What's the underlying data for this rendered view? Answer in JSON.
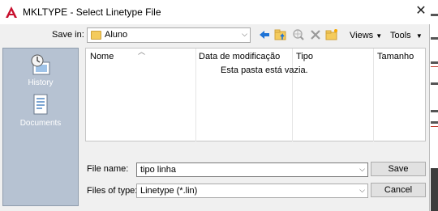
{
  "window": {
    "title": "MKLTYPE - Select Linetype File",
    "close_glyph": "✕"
  },
  "toolbar": {
    "save_in_label": "Save in:",
    "save_in_value": "Aluno",
    "views_label": "Views",
    "tools_label": "Tools",
    "icons": [
      "back-arrow-icon",
      "folder-up-icon",
      "search-web-icon",
      "delete-icon",
      "new-folder-icon"
    ]
  },
  "places": [
    {
      "label": "History",
      "icon": "history-icon"
    },
    {
      "label": "Documents",
      "icon": "documents-icon"
    }
  ],
  "file_list": {
    "columns": [
      "Nome",
      "Data de modificação",
      "Tipo",
      "Tamanho"
    ],
    "empty_message": "Esta pasta está vazia."
  },
  "form": {
    "file_name_label": "File name:",
    "file_name_value": "tipo linha",
    "files_of_type_label": "Files of type:",
    "files_of_type_value": "Linetype (*.lin)",
    "save_button": "Save",
    "cancel_button": "Cancel"
  },
  "colors": {
    "accent_blue": "#1e73d6",
    "folder_yellow": "#f4cb5c",
    "places_panel": "#b6c2d2",
    "autocad_red": "#c8102e"
  }
}
